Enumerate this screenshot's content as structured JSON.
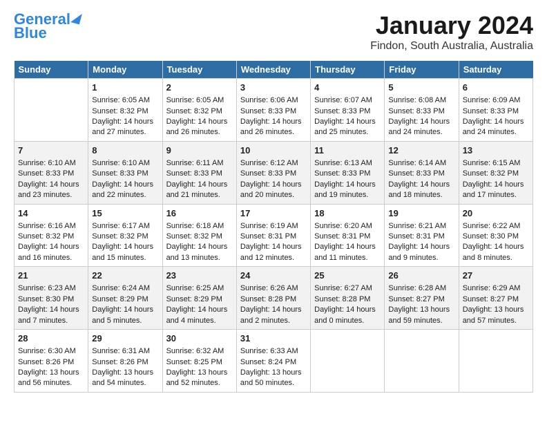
{
  "header": {
    "logo_line1": "General",
    "logo_line2": "Blue",
    "month": "January 2024",
    "location": "Findon, South Australia, Australia"
  },
  "weekdays": [
    "Sunday",
    "Monday",
    "Tuesday",
    "Wednesday",
    "Thursday",
    "Friday",
    "Saturday"
  ],
  "weeks": [
    [
      {
        "day": "",
        "sunrise": "",
        "sunset": "",
        "daylight": ""
      },
      {
        "day": "1",
        "sunrise": "Sunrise: 6:05 AM",
        "sunset": "Sunset: 8:32 PM",
        "daylight": "Daylight: 14 hours and 27 minutes."
      },
      {
        "day": "2",
        "sunrise": "Sunrise: 6:05 AM",
        "sunset": "Sunset: 8:32 PM",
        "daylight": "Daylight: 14 hours and 26 minutes."
      },
      {
        "day": "3",
        "sunrise": "Sunrise: 6:06 AM",
        "sunset": "Sunset: 8:33 PM",
        "daylight": "Daylight: 14 hours and 26 minutes."
      },
      {
        "day": "4",
        "sunrise": "Sunrise: 6:07 AM",
        "sunset": "Sunset: 8:33 PM",
        "daylight": "Daylight: 14 hours and 25 minutes."
      },
      {
        "day": "5",
        "sunrise": "Sunrise: 6:08 AM",
        "sunset": "Sunset: 8:33 PM",
        "daylight": "Daylight: 14 hours and 24 minutes."
      },
      {
        "day": "6",
        "sunrise": "Sunrise: 6:09 AM",
        "sunset": "Sunset: 8:33 PM",
        "daylight": "Daylight: 14 hours and 24 minutes."
      }
    ],
    [
      {
        "day": "7",
        "sunrise": "Sunrise: 6:10 AM",
        "sunset": "Sunset: 8:33 PM",
        "daylight": "Daylight: 14 hours and 23 minutes."
      },
      {
        "day": "8",
        "sunrise": "Sunrise: 6:10 AM",
        "sunset": "Sunset: 8:33 PM",
        "daylight": "Daylight: 14 hours and 22 minutes."
      },
      {
        "day": "9",
        "sunrise": "Sunrise: 6:11 AM",
        "sunset": "Sunset: 8:33 PM",
        "daylight": "Daylight: 14 hours and 21 minutes."
      },
      {
        "day": "10",
        "sunrise": "Sunrise: 6:12 AM",
        "sunset": "Sunset: 8:33 PM",
        "daylight": "Daylight: 14 hours and 20 minutes."
      },
      {
        "day": "11",
        "sunrise": "Sunrise: 6:13 AM",
        "sunset": "Sunset: 8:33 PM",
        "daylight": "Daylight: 14 hours and 19 minutes."
      },
      {
        "day": "12",
        "sunrise": "Sunrise: 6:14 AM",
        "sunset": "Sunset: 8:33 PM",
        "daylight": "Daylight: 14 hours and 18 minutes."
      },
      {
        "day": "13",
        "sunrise": "Sunrise: 6:15 AM",
        "sunset": "Sunset: 8:32 PM",
        "daylight": "Daylight: 14 hours and 17 minutes."
      }
    ],
    [
      {
        "day": "14",
        "sunrise": "Sunrise: 6:16 AM",
        "sunset": "Sunset: 8:32 PM",
        "daylight": "Daylight: 14 hours and 16 minutes."
      },
      {
        "day": "15",
        "sunrise": "Sunrise: 6:17 AM",
        "sunset": "Sunset: 8:32 PM",
        "daylight": "Daylight: 14 hours and 15 minutes."
      },
      {
        "day": "16",
        "sunrise": "Sunrise: 6:18 AM",
        "sunset": "Sunset: 8:32 PM",
        "daylight": "Daylight: 14 hours and 13 minutes."
      },
      {
        "day": "17",
        "sunrise": "Sunrise: 6:19 AM",
        "sunset": "Sunset: 8:31 PM",
        "daylight": "Daylight: 14 hours and 12 minutes."
      },
      {
        "day": "18",
        "sunrise": "Sunrise: 6:20 AM",
        "sunset": "Sunset: 8:31 PM",
        "daylight": "Daylight: 14 hours and 11 minutes."
      },
      {
        "day": "19",
        "sunrise": "Sunrise: 6:21 AM",
        "sunset": "Sunset: 8:31 PM",
        "daylight": "Daylight: 14 hours and 9 minutes."
      },
      {
        "day": "20",
        "sunrise": "Sunrise: 6:22 AM",
        "sunset": "Sunset: 8:30 PM",
        "daylight": "Daylight: 14 hours and 8 minutes."
      }
    ],
    [
      {
        "day": "21",
        "sunrise": "Sunrise: 6:23 AM",
        "sunset": "Sunset: 8:30 PM",
        "daylight": "Daylight: 14 hours and 7 minutes."
      },
      {
        "day": "22",
        "sunrise": "Sunrise: 6:24 AM",
        "sunset": "Sunset: 8:29 PM",
        "daylight": "Daylight: 14 hours and 5 minutes."
      },
      {
        "day": "23",
        "sunrise": "Sunrise: 6:25 AM",
        "sunset": "Sunset: 8:29 PM",
        "daylight": "Daylight: 14 hours and 4 minutes."
      },
      {
        "day": "24",
        "sunrise": "Sunrise: 6:26 AM",
        "sunset": "Sunset: 8:28 PM",
        "daylight": "Daylight: 14 hours and 2 minutes."
      },
      {
        "day": "25",
        "sunrise": "Sunrise: 6:27 AM",
        "sunset": "Sunset: 8:28 PM",
        "daylight": "Daylight: 14 hours and 0 minutes."
      },
      {
        "day": "26",
        "sunrise": "Sunrise: 6:28 AM",
        "sunset": "Sunset: 8:27 PM",
        "daylight": "Daylight: 13 hours and 59 minutes."
      },
      {
        "day": "27",
        "sunrise": "Sunrise: 6:29 AM",
        "sunset": "Sunset: 8:27 PM",
        "daylight": "Daylight: 13 hours and 57 minutes."
      }
    ],
    [
      {
        "day": "28",
        "sunrise": "Sunrise: 6:30 AM",
        "sunset": "Sunset: 8:26 PM",
        "daylight": "Daylight: 13 hours and 56 minutes."
      },
      {
        "day": "29",
        "sunrise": "Sunrise: 6:31 AM",
        "sunset": "Sunset: 8:26 PM",
        "daylight": "Daylight: 13 hours and 54 minutes."
      },
      {
        "day": "30",
        "sunrise": "Sunrise: 6:32 AM",
        "sunset": "Sunset: 8:25 PM",
        "daylight": "Daylight: 13 hours and 52 minutes."
      },
      {
        "day": "31",
        "sunrise": "Sunrise: 6:33 AM",
        "sunset": "Sunset: 8:24 PM",
        "daylight": "Daylight: 13 hours and 50 minutes."
      },
      {
        "day": "",
        "sunrise": "",
        "sunset": "",
        "daylight": ""
      },
      {
        "day": "",
        "sunrise": "",
        "sunset": "",
        "daylight": ""
      },
      {
        "day": "",
        "sunrise": "",
        "sunset": "",
        "daylight": ""
      }
    ]
  ]
}
